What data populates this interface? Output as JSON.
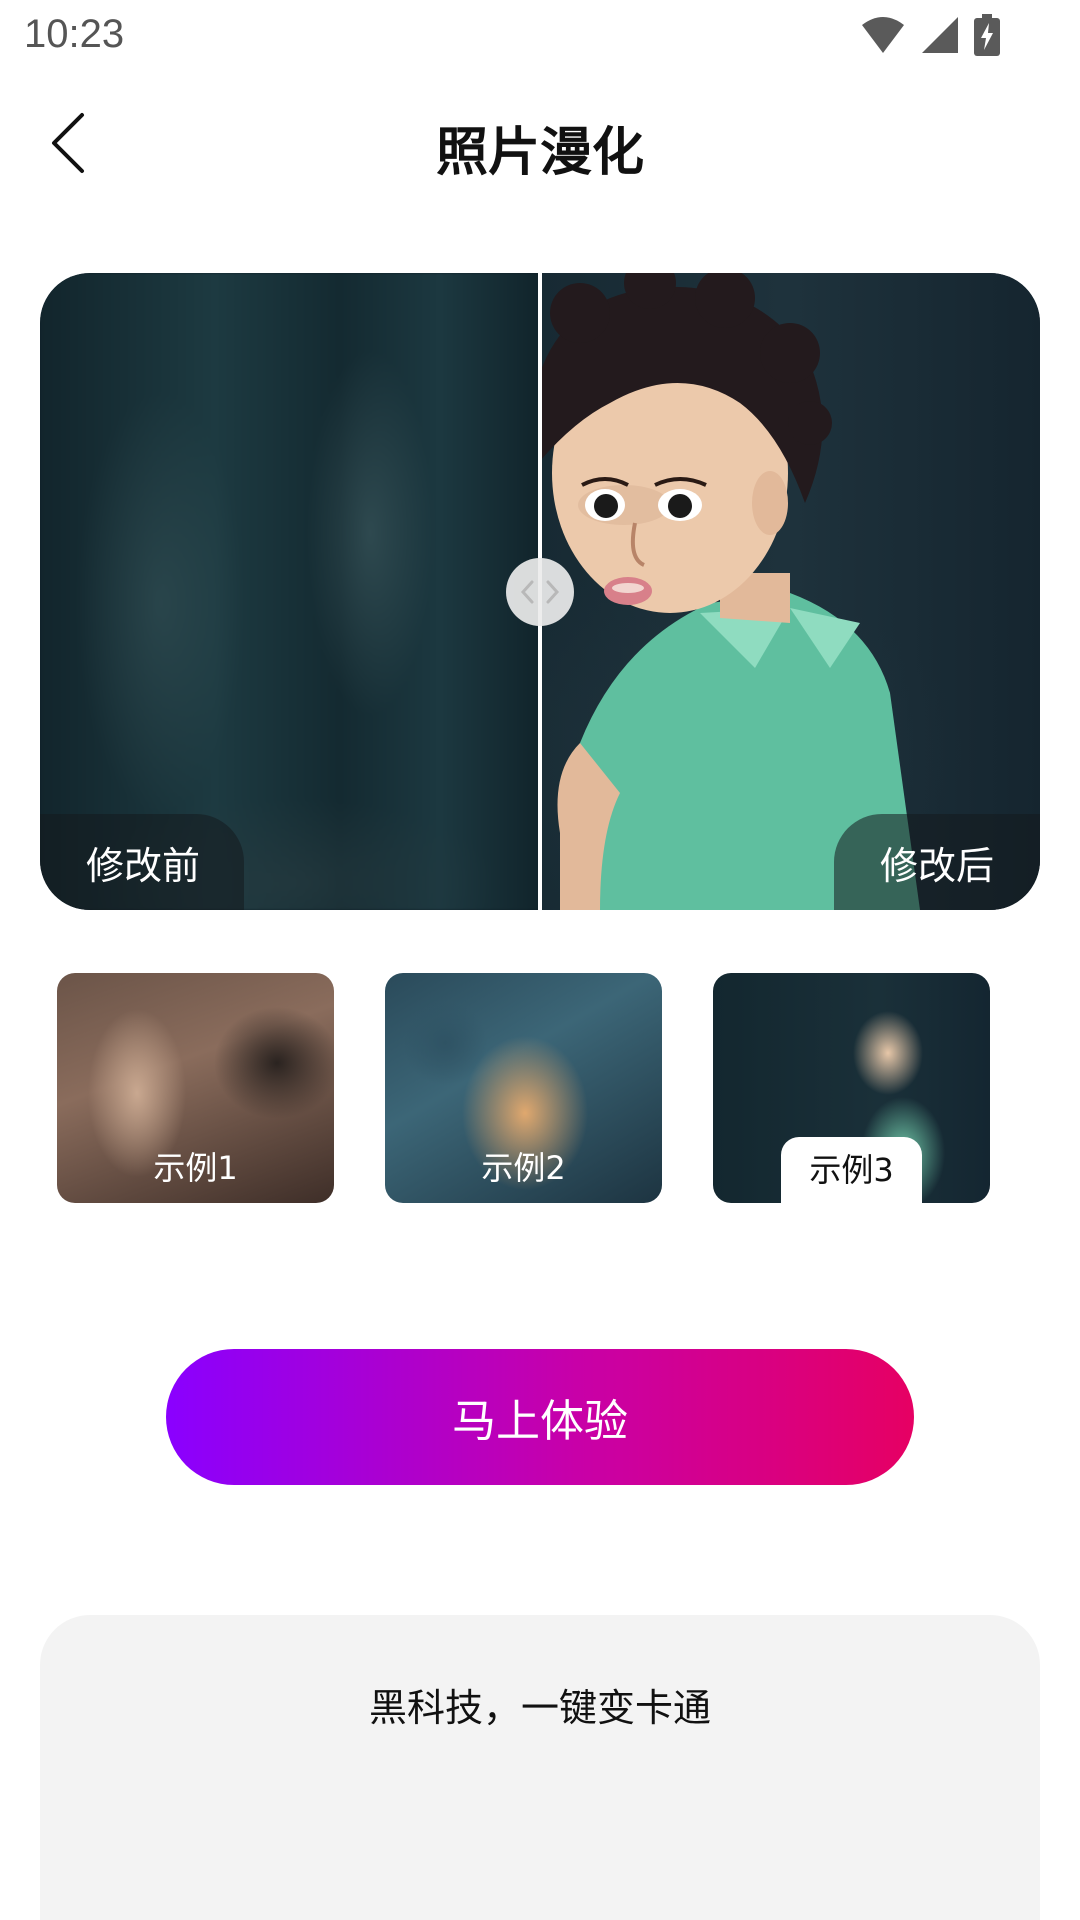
{
  "status_bar": {
    "time": "10:23",
    "icons": [
      "wifi-icon",
      "signal-icon",
      "battery-charging-icon"
    ]
  },
  "header": {
    "title": "照片漫化",
    "back_icon": "chevron-left-icon"
  },
  "compare": {
    "before_label": "修改前",
    "after_label": "修改后",
    "slider_position": 0.5
  },
  "examples": [
    {
      "label": "示例1",
      "selected": false
    },
    {
      "label": "示例2",
      "selected": false
    },
    {
      "label": "示例3",
      "selected": true
    }
  ],
  "cta": {
    "label": "马上体验",
    "gradient": [
      "#8a00ff",
      "#e60063"
    ]
  },
  "info": {
    "headline": "黑科技，一键变卡通"
  }
}
